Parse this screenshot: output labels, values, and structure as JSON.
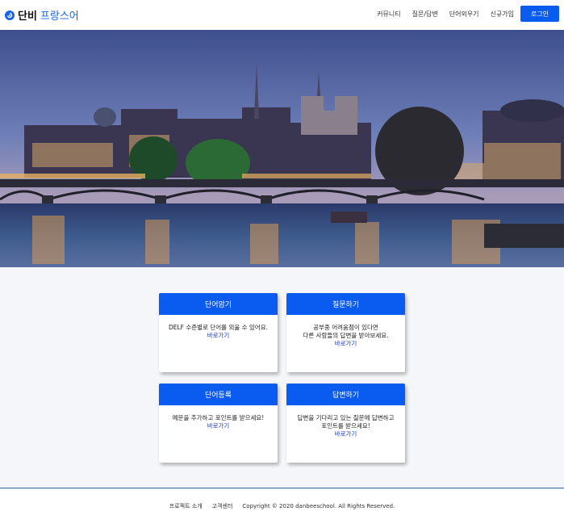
{
  "header": {
    "logo_text_a": "단비",
    "logo_text_b": "프랑스어",
    "nav": [
      "커뮤니티",
      "질문/답변",
      "단어외우기",
      "신규가입"
    ],
    "login_label": "로그인"
  },
  "cards": [
    {
      "title": "단어암기",
      "lines": [
        "DELF 수준별로 단어를 외울 수 있어요."
      ],
      "link": "바로가기"
    },
    {
      "title": "질문하기",
      "lines": [
        "공부중 어려움점이 있다면",
        "다른 사람들의 답변을 받아보세요."
      ],
      "link": "바로가기"
    },
    {
      "title": "단어등록",
      "lines": [
        "예문을 추가하고 포인트를 받으세요!"
      ],
      "link": "바로가기"
    },
    {
      "title": "답변하기",
      "lines": [
        "답변을 기다리고 있는 질문에 답변하고",
        "포인트를 받으세요!"
      ],
      "link": "바로가기"
    }
  ],
  "footer": {
    "project_intro": "프로젝트 소개",
    "support": "고객센터",
    "copyright": "Copyright © 2020 danbeeschool. All Rights Reserved."
  },
  "colors": {
    "accent": "#0a5cf0",
    "link": "#1a3cbe",
    "footer_line": "#2c5f9a"
  },
  "icons": {
    "logo": "blue-circle-logo-icon"
  }
}
